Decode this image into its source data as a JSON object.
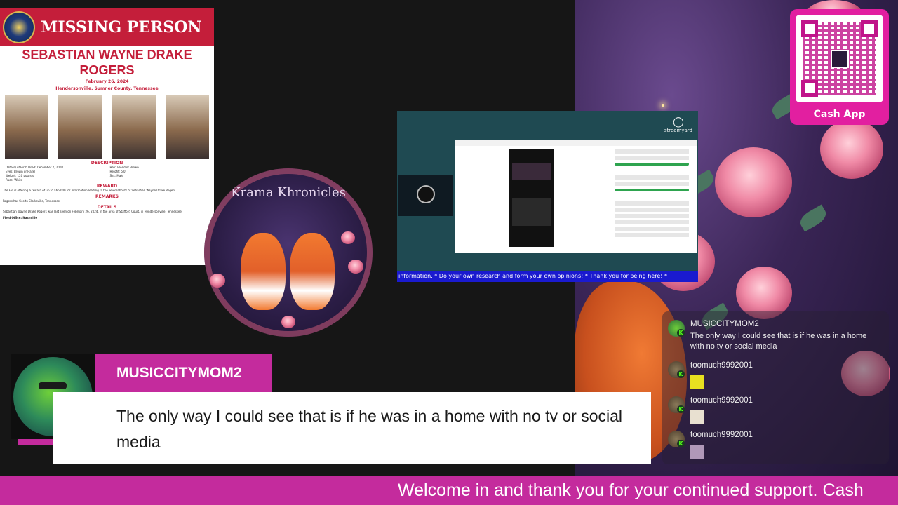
{
  "poster": {
    "title": "MISSING PERSON",
    "name": "SEBASTIAN WAYNE DRAKE ROGERS",
    "date": "February 26, 2024",
    "place": "Hendersonville, Sumner County, Tennessee",
    "sections": {
      "description": "DESCRIPTION",
      "reward": "REWARD",
      "remarks": "REMARKS",
      "details": "DETAILS"
    },
    "description_rows": [
      [
        "Date(s) of Birth Used: December 7, 2008",
        "Hair: Blond or Brown"
      ],
      [
        "Eyes: Brown or Hazel",
        "Height: 5'0\""
      ],
      [
        "Weight: 120 pounds",
        "Sex: Male"
      ],
      [
        "Race: White",
        ""
      ]
    ],
    "reward_text": "The FBI is offering a reward of up to $66,000 for information leading to the whereabouts of Sebastian Wayne Drake Rogers.",
    "remarks_text": "Rogers has ties to Clarksville, Tennessee.",
    "details_text": "Sebastian Wayne Drake Rogers was last seen on February 26, 2024, in the area of Stafford Court, in Hendersonville, Tennessee.",
    "field_office": "Field Office: Nashville"
  },
  "krama": {
    "title": "Krama Khronicles"
  },
  "streamyard": {
    "logo": "streamyard",
    "ticker": "information. * Do your own research and form your own opinions! * Thank you for being here! *"
  },
  "cash_app": {
    "label": "Cash App"
  },
  "chat": [
    {
      "user": "MUSICCITYMOM2",
      "message": "The only way I could see that is if he was in a home with no tv or social media"
    },
    {
      "user": "toomuch9992001",
      "emote": "emote-1"
    },
    {
      "user": "toomuch9992001",
      "emote": "emote-2"
    },
    {
      "user": "toomuch9992001",
      "emote": "emote-3"
    }
  ],
  "featured": {
    "user": "MUSICCITYMOM2",
    "message": "The only way I could see that is if he was in a home with no tv or social media",
    "badge": "K"
  },
  "ticker": {
    "text": "Welcome in and thank you for your continued support. Cash"
  },
  "colors": {
    "accent_pink": "#c42b9d",
    "fbi_red": "#c41e3a",
    "kick_green": "#53fc18"
  }
}
